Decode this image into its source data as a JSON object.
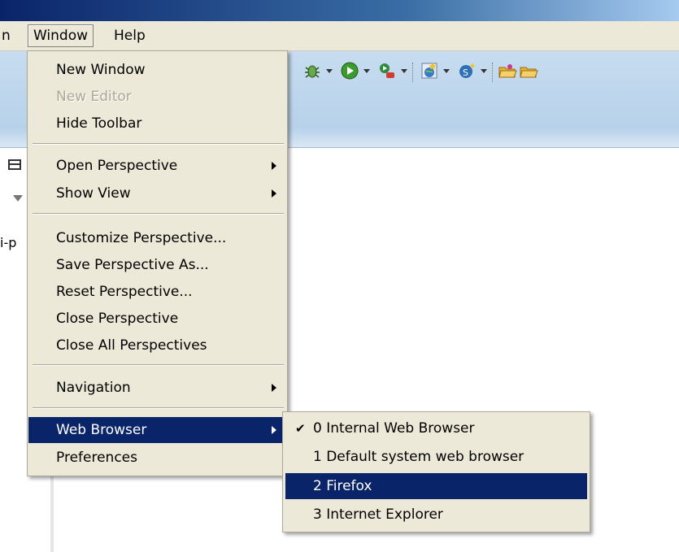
{
  "menubar": {
    "truncated_label": "n",
    "window_label": "Window",
    "help_label": "Help"
  },
  "window_menu": {
    "items": [
      {
        "label": "New Window"
      },
      {
        "label": "New Editor",
        "disabled": true
      },
      {
        "label": "Hide Toolbar"
      },
      {
        "label": "Open Perspective",
        "submenu": true
      },
      {
        "label": "Show View",
        "submenu": true
      },
      {
        "label": "Customize Perspective..."
      },
      {
        "label": "Save Perspective As..."
      },
      {
        "label": "Reset Perspective..."
      },
      {
        "label": "Close Perspective"
      },
      {
        "label": "Close All Perspectives"
      },
      {
        "label": "Navigation",
        "submenu": true
      },
      {
        "label": "Web Browser",
        "submenu": true,
        "highlighted": true
      },
      {
        "label": "Preferences"
      }
    ]
  },
  "web_browser_submenu": {
    "items": [
      {
        "label": "0 Internal Web Browser",
        "checked": true
      },
      {
        "label": "1 Default system web browser"
      },
      {
        "label": "2 Firefox",
        "highlighted": true
      },
      {
        "label": "3 Internet Explorer"
      }
    ],
    "check_glyph": "✔"
  },
  "left_pane": {
    "fragment_text": "i-p"
  },
  "toolbar": {
    "icons": [
      "debug-bug-icon",
      "run-icon",
      "external-tools-icon",
      "new-server-icon",
      "new-class-icon",
      "open-folder-icon",
      "open-folder-icon"
    ]
  },
  "colors": {
    "menu_bg": "#ece9d8",
    "highlight": "#0a246a",
    "toolbar_bg": "#b7d2ea",
    "disabled_text": "#aca899"
  }
}
